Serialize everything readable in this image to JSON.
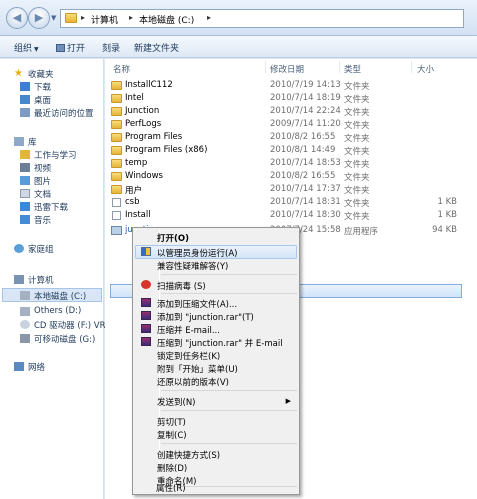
{
  "address": {
    "crumbs": [
      "计算机",
      "本地磁盘 (C:)"
    ],
    "sep": "▸"
  },
  "toolbar": {
    "organize": "组织",
    "open": "打开",
    "burn": "刻录",
    "new_folder": "新建文件夹"
  },
  "nav": {
    "favorites": "收藏夹",
    "downloads": "下载",
    "desktop": "桌面",
    "recent": "最近访问的位置",
    "libraries": "库",
    "work_study": "工作与学习",
    "videos": "视频",
    "pictures": "图片",
    "documents": "文档",
    "xunlei": "迅雷下载",
    "music": "音乐",
    "homegroup": "家庭组",
    "computer": "计算机",
    "local_disk": "本地磁盘 (C:)",
    "others": "Others (D:)",
    "cd_drive": "CD 驱动器 (F:) VRM",
    "removable": "可移动磁盘 (G:)",
    "network": "网络"
  },
  "columns": {
    "name": "名称",
    "date": "修改日期",
    "type": "类型",
    "size": "大小"
  },
  "files": [
    {
      "name": "InstallC112",
      "date": "2010/7/19 14:13",
      "type": "文件夹",
      "size": ""
    },
    {
      "name": "Intel",
      "date": "2010/7/14 18:19",
      "type": "文件夹",
      "size": ""
    },
    {
      "name": "Junction",
      "date": "2010/7/14 22:24",
      "type": "文件夹",
      "size": ""
    },
    {
      "name": "PerfLogs",
      "date": "2009/7/14 11:20",
      "type": "文件夹",
      "size": ""
    },
    {
      "name": "Program Files",
      "date": "2010/8/2 16:55",
      "type": "文件夹",
      "size": ""
    },
    {
      "name": "Program Files (x86)",
      "date": "2010/8/1 14:49",
      "type": "文件夹",
      "size": ""
    },
    {
      "name": "temp",
      "date": "2010/7/14 18:53",
      "type": "文件夹",
      "size": ""
    },
    {
      "name": "Windows",
      "date": "2010/8/2 16:55",
      "type": "文件夹",
      "size": ""
    },
    {
      "name": "用户",
      "date": "2010/7/14 17:37",
      "type": "文件夹",
      "size": ""
    },
    {
      "name": "csb",
      "date": "2010/7/14 18:31",
      "type": "文件夹",
      "size": "1 KB"
    },
    {
      "name": "Install",
      "date": "2010/7/14 18:30",
      "type": "文件夹",
      "size": "1 KB"
    },
    {
      "name": "junction",
      "date": "2007/7/24 15:58",
      "type": "应用程序",
      "size": "94 KB"
    }
  ],
  "menu": {
    "open": "打开(O)",
    "run_admin": "以管理员身份运行(A)",
    "compat": "兼容性疑难解答(Y)",
    "scan": "扫描病毒 (S)",
    "add_archive": "添加到压缩文件(A)...",
    "add_rar": "添加到 \"junction.rar\"(T)",
    "compress_email": "压缩并 E-mail...",
    "compress_rar_email": "压缩到 \"junction.rar\" 并 E-mail",
    "pin_taskbar": "锁定到任务栏(K)",
    "pin_start": "附到「开始」菜单(U)",
    "restore": "还原以前的版本(V)",
    "send_to": "发送到(N)",
    "cut": "剪切(T)",
    "copy": "复制(C)",
    "shortcut": "创建快捷方式(S)",
    "delete": "删除(D)",
    "rename": "重命名(M)",
    "properties": "属性(R)",
    "arrow": "▶"
  }
}
